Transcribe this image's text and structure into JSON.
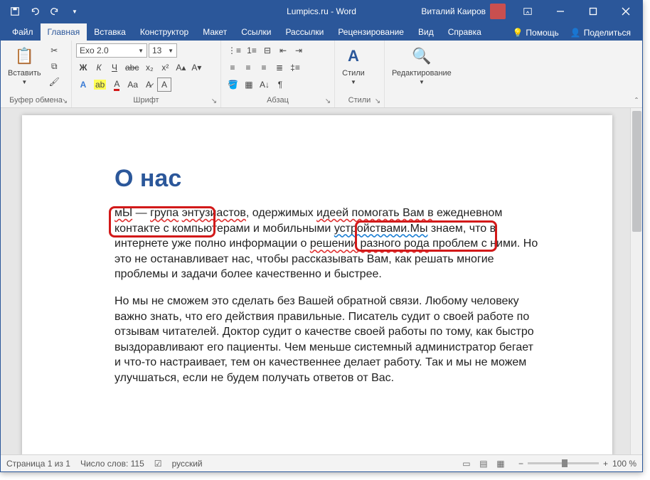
{
  "titlebar": {
    "title": "Lumpics.ru - Word",
    "username": "Виталий Каиров"
  },
  "tabs": {
    "file": "Файл",
    "home": "Главная",
    "insert": "Вставка",
    "design": "Конструктор",
    "layout": "Макет",
    "references": "Ссылки",
    "mailings": "Рассылки",
    "review": "Рецензирование",
    "view": "Вид",
    "help": "Справка",
    "tell_me": "Помощь",
    "share": "Поделиться"
  },
  "ribbon": {
    "clipboard": {
      "label": "Буфер обмена",
      "paste": "Вставить"
    },
    "font": {
      "label": "Шрифт",
      "name": "Exo 2.0",
      "size": "13"
    },
    "paragraph": {
      "label": "Абзац"
    },
    "styles": {
      "label": "Стили",
      "button": "Стили"
    },
    "editing": {
      "label": "",
      "button": "Редактирование"
    }
  },
  "document": {
    "heading": "О нас",
    "p1_parts": {
      "a": "мЫ",
      "b": " — ",
      "c": "група",
      "d": " ",
      "e": "энтузиастов",
      "f": ", одержимых ",
      "g": "идеей помогать Вам в",
      "h": " ежедневном контакте с компьютерами и мобильными ",
      "i": "устройствами.Мы",
      "j": " знаем, что в интернете уже полно информации о ",
      "k": "решении разного рода",
      "l": " проблем с ними. Но это не останавливает нас, чтобы рассказывать Вам, как решать многие проблемы и задачи более качественно и быстрее."
    },
    "p2": "Но мы не сможем это сделать без Вашей обратной связи. Любому человеку важно знать, что его действия правильные. Писатель судит о своей работе по отзывам читателей. Доктор судит о качестве своей работы по тому, как быстро выздоравливают его пациенты. Чем меньше системный администратор бегает и что-то настраивает, тем он качественнее делает работу. Так и мы не можем улучшаться, если не будем получать ответов от Вас."
  },
  "statusbar": {
    "page": "Страница 1 из 1",
    "words": "Число слов: 115",
    "lang": "русский",
    "zoom": "100 %"
  }
}
